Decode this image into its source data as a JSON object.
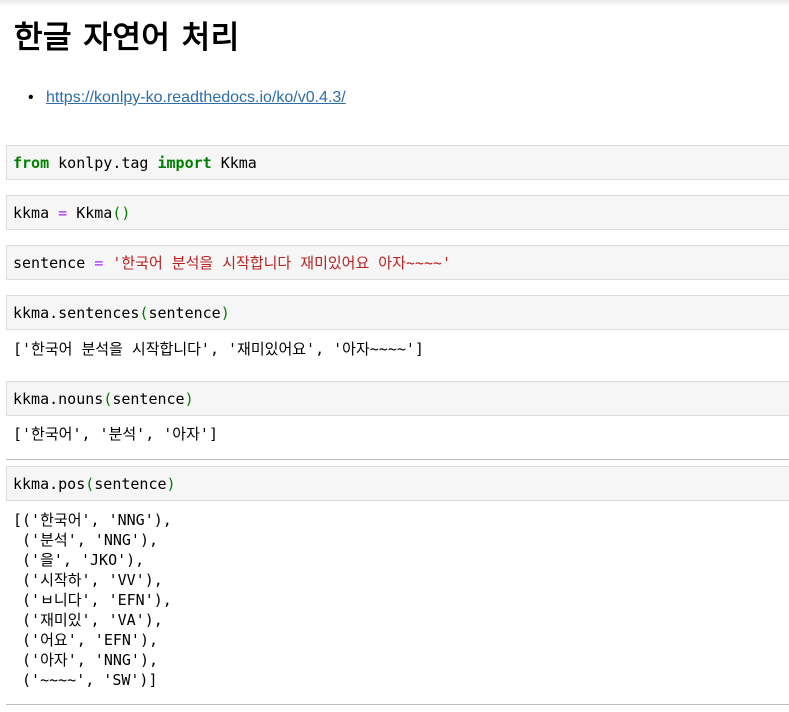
{
  "markdown": {
    "title": "한글 자연어 처리",
    "link": "https://konlpy-ko.readthedocs.io/ko/v0.4.3/"
  },
  "cells": {
    "c1": {
      "kw1": "from",
      "mod": " konlpy.tag ",
      "kw2": "import",
      "name": " Kkma"
    },
    "c2": {
      "lhs": "kkma ",
      "op": "=",
      "mid": " Kkma",
      "parens": "()"
    },
    "c3": {
      "lhs": "sentence ",
      "op": "=",
      "sp": " ",
      "str": "'한국어 분석을 시작합니다 재미있어요 아자~~~~'"
    },
    "c4": {
      "fn": "kkma.sentences",
      "lp": "(",
      "arg": "sentence",
      "rp": ")",
      "output": "['한국어 분석을 시작합니다', '재미있어요', '아자~~~~']"
    },
    "c5": {
      "fn": "kkma.nouns",
      "lp": "(",
      "arg": "sentence",
      "rp": ")",
      "output": "['한국어', '분석', '아자']"
    },
    "c6": {
      "fn": "kkma.pos",
      "lp": "(",
      "arg": "sentence",
      "rp": ")",
      "output": "[('한국어', 'NNG'),\n ('분석', 'NNG'),\n ('을', 'JKO'),\n ('시작하', 'VV'),\n ('ㅂ니다', 'EFN'),\n ('재미있', 'VA'),\n ('어요', 'EFN'),\n ('아자', 'NNG'),\n ('~~~~', 'SW')]"
    }
  },
  "colors": {
    "keyword": "#008000",
    "operator": "#aa22ff",
    "string": "#ba2121",
    "link": "#2e6ea6",
    "cell_bg": "#f6f6f6"
  }
}
